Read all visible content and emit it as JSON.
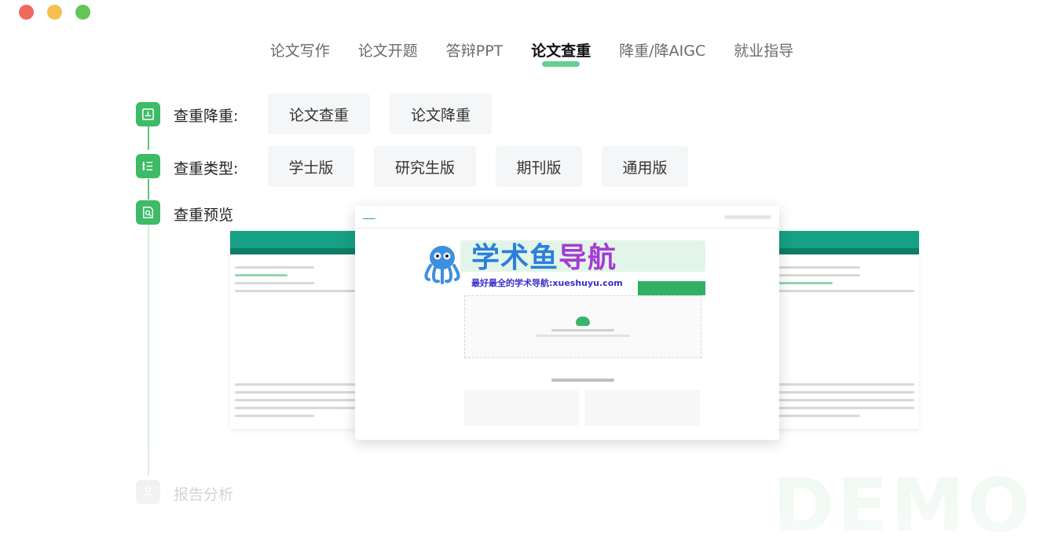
{
  "window": {
    "controls": [
      "close",
      "minimize",
      "maximize"
    ]
  },
  "topnav": {
    "tabs": [
      {
        "label": "论文写作",
        "active": false
      },
      {
        "label": "论文开题",
        "active": false
      },
      {
        "label": "答辩PPT",
        "active": false
      },
      {
        "label": "论文查重",
        "active": true
      },
      {
        "label": "降重/降AIGC",
        "active": false
      },
      {
        "label": "就业指导",
        "active": false
      }
    ]
  },
  "steps": {
    "dedup": {
      "label": "查重降重:",
      "options": [
        "论文查重",
        "论文降重"
      ]
    },
    "type": {
      "label": "查重类型:",
      "options": [
        "学士版",
        "研究生版",
        "期刊版",
        "通用版"
      ]
    },
    "preview": {
      "label": "查重预览"
    },
    "report": {
      "label": "报告分析"
    }
  },
  "logo": {
    "title_part1": "学术鱼",
    "title_part2": "导航",
    "subtitle": "最好最全的学术导航:xueshuyu.com"
  },
  "watermark": "DEMO",
  "colors": {
    "accent": "#3dbb67",
    "active_underline": "#4cc67a",
    "logo_blue": "#2b7fdc",
    "logo_purple": "#a43bd4"
  }
}
